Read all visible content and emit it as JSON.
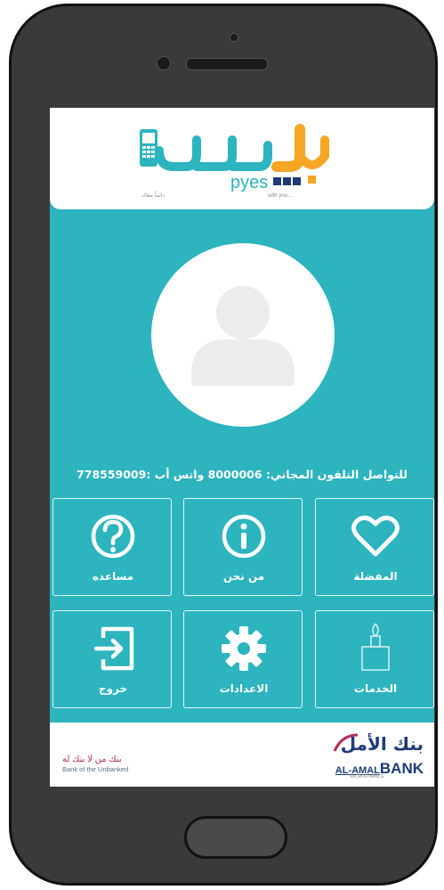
{
  "app": {
    "logo_ar": "بيس",
    "logo_en": "pyes",
    "logo_tag_en": "with you...",
    "logo_tag_ar": "دائماً معاك"
  },
  "hotline": "للتواصل التلفون المجاني: 8000006 واتس أب :778559009",
  "tiles": [
    {
      "label": "المفضلة",
      "icon": "heart-icon"
    },
    {
      "label": "من نحن",
      "icon": "info-icon"
    },
    {
      "label": "مساعده",
      "icon": "help-icon"
    },
    {
      "label": "الخدمات",
      "icon": "candle-icon"
    },
    {
      "label": "الاعدادات",
      "icon": "gear-icon"
    },
    {
      "label": "خروج",
      "icon": "exit-icon"
    }
  ],
  "footer": {
    "slogan_ar": "بنك من لا بنك له",
    "slogan_en": "Bank of the Unbanked",
    "bank_ar": "بنك الأمل",
    "bank_en_1": "AL-AMAL",
    "bank_en_2": "BANK",
    "bank_sub": "MICROFINANCE"
  },
  "colors": {
    "teal": "#2cb4bf",
    "logo_teal": "#2cb4bf",
    "logo_orange": "#f5a623",
    "bank_blue": "#1e3a78",
    "slogan_red": "#b22c5a"
  }
}
